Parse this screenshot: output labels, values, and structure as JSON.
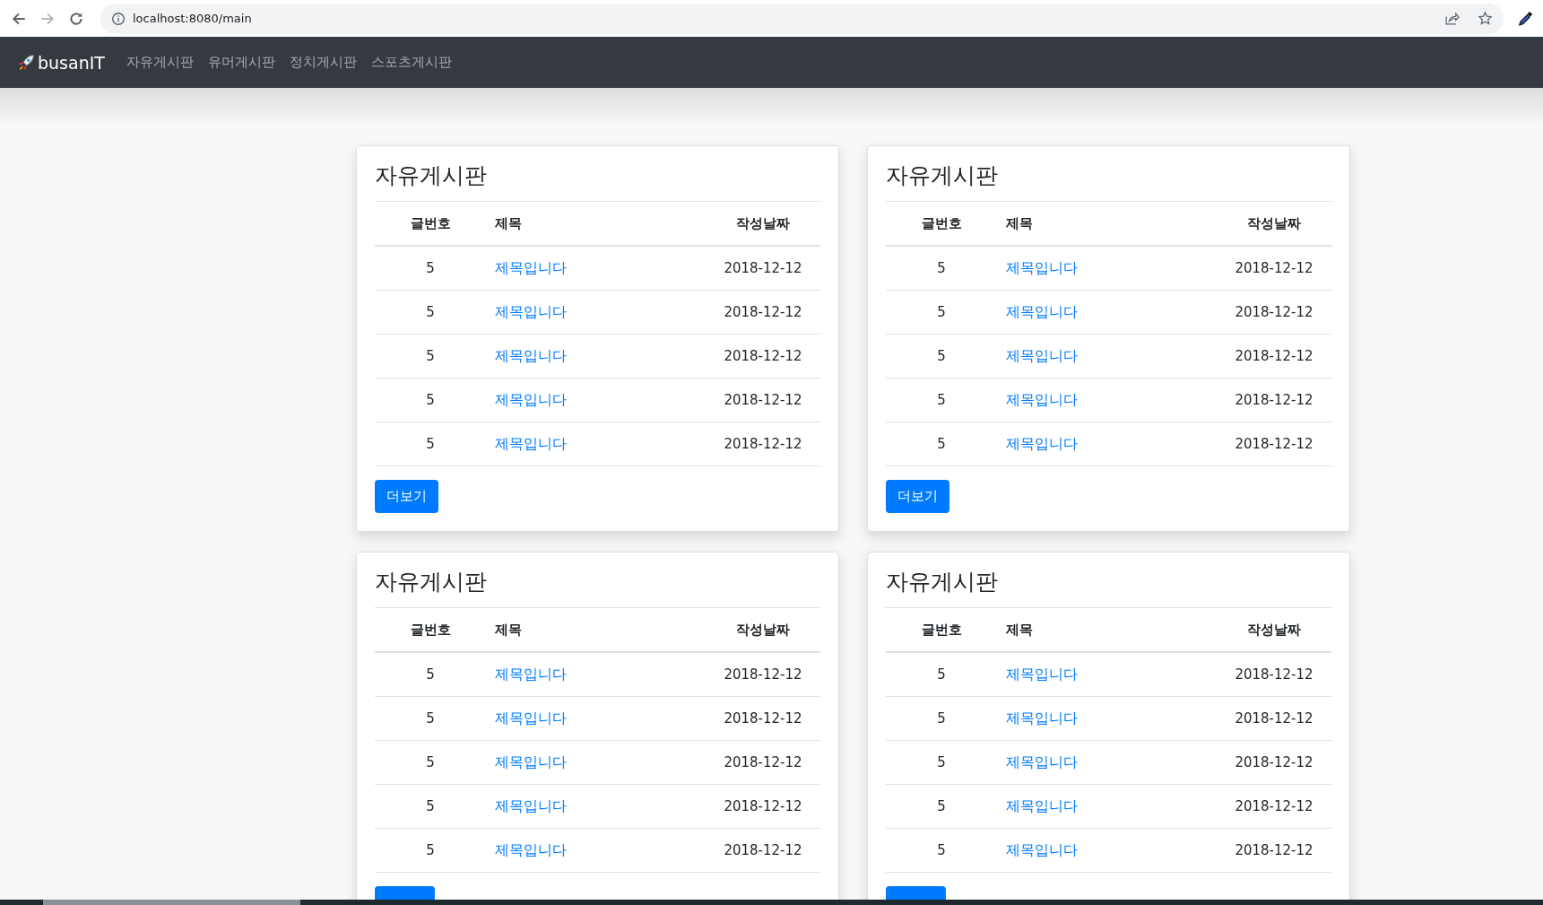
{
  "browser": {
    "url": "localhost:8080/main",
    "forward_disabled": true
  },
  "navbar": {
    "brand": "busanIT",
    "items": [
      "자유게시판",
      "유머게시판",
      "정치게시판",
      "스포츠게시판"
    ]
  },
  "boards": [
    {
      "title": "자유게시판",
      "columns": [
        "글번호",
        "제목",
        "작성날짜"
      ],
      "button": "더보기",
      "rows": [
        {
          "no": "5",
          "title": "제목입니다",
          "date": "2018-12-12"
        },
        {
          "no": "5",
          "title": "제목입니다",
          "date": "2018-12-12"
        },
        {
          "no": "5",
          "title": "제목입니다",
          "date": "2018-12-12"
        },
        {
          "no": "5",
          "title": "제목입니다",
          "date": "2018-12-12"
        },
        {
          "no": "5",
          "title": "제목입니다",
          "date": "2018-12-12"
        }
      ]
    },
    {
      "title": "자유게시판",
      "columns": [
        "글번호",
        "제목",
        "작성날짜"
      ],
      "button": "더보기",
      "rows": [
        {
          "no": "5",
          "title": "제목입니다",
          "date": "2018-12-12"
        },
        {
          "no": "5",
          "title": "제목입니다",
          "date": "2018-12-12"
        },
        {
          "no": "5",
          "title": "제목입니다",
          "date": "2018-12-12"
        },
        {
          "no": "5",
          "title": "제목입니다",
          "date": "2018-12-12"
        },
        {
          "no": "5",
          "title": "제목입니다",
          "date": "2018-12-12"
        }
      ]
    },
    {
      "title": "자유게시판",
      "columns": [
        "글번호",
        "제목",
        "작성날짜"
      ],
      "button_partial": true,
      "rows": [
        {
          "no": "5",
          "title": "제목입니다",
          "date": "2018-12-12"
        },
        {
          "no": "5",
          "title": "제목입니다",
          "date": "2018-12-12"
        },
        {
          "no": "5",
          "title": "제목입니다",
          "date": "2018-12-12"
        },
        {
          "no": "5",
          "title": "제목입니다",
          "date": "2018-12-12"
        },
        {
          "no": "5",
          "title": "제목입니다",
          "date": "2018-12-12"
        }
      ]
    },
    {
      "title": "자유게시판",
      "columns": [
        "글번호",
        "제목",
        "작성날짜"
      ],
      "button_partial": true,
      "rows": [
        {
          "no": "5",
          "title": "제목입니다",
          "date": "2018-12-12"
        },
        {
          "no": "5",
          "title": "제목입니다",
          "date": "2018-12-12"
        },
        {
          "no": "5",
          "title": "제목입니다",
          "date": "2018-12-12"
        },
        {
          "no": "5",
          "title": "제목입니다",
          "date": "2018-12-12"
        },
        {
          "no": "5",
          "title": "제목입니다",
          "date": "2018-12-12"
        }
      ]
    }
  ]
}
